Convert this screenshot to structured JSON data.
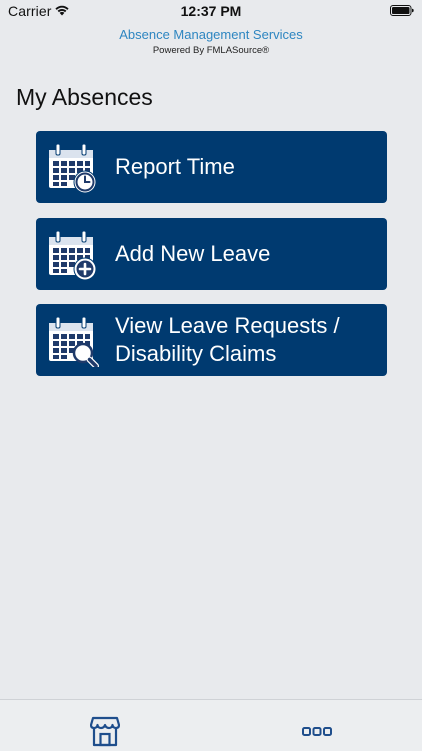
{
  "status_bar": {
    "carrier": "Carrier",
    "time": "12:37 PM",
    "wifi_icon": "wifi-icon",
    "battery_icon": "battery-icon"
  },
  "header": {
    "title": "Absence Management Services",
    "subtitle": "Powered By FMLASource®"
  },
  "page": {
    "title": "My Absences"
  },
  "menu": [
    {
      "label": "Report Time",
      "icon": "calendar-clock-icon"
    },
    {
      "label": "Add New Leave",
      "icon": "calendar-plus-icon"
    },
    {
      "label_line1": "View Leave Requests /",
      "label_line2": "Disability Claims",
      "icon": "calendar-search-icon"
    }
  ],
  "tab_bar": {
    "items": [
      {
        "icon": "store-home-icon"
      },
      {
        "icon": "more-icon"
      }
    ]
  },
  "colors": {
    "background": "#e8eaed",
    "button": "#003a70",
    "accent": "#2e86c1",
    "icon_dark": "#1f3a6a"
  }
}
